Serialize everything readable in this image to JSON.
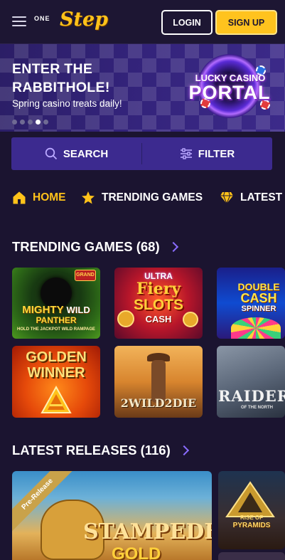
{
  "header": {
    "logo_one": "ONE",
    "logo_step": "Step",
    "login_label": "LOGIN",
    "signup_label": "SIGN UP"
  },
  "banner": {
    "title": "ENTER THE RABBITHOLE!",
    "subtitle": "Spring casino treats daily!",
    "portal_line1": "LUCKY CASINO",
    "portal_line2": "PORTAL",
    "slides_total": 5,
    "active_slide": 4
  },
  "search_bar": {
    "search_label": "SEARCH",
    "filter_label": "FILTER"
  },
  "nav": {
    "items": [
      {
        "label": "HOME",
        "icon": "home-icon",
        "active": true
      },
      {
        "label": "TRENDING GAMES",
        "icon": "star-icon",
        "active": false
      },
      {
        "label": "LATEST",
        "icon": "diamond-icon",
        "active": false
      }
    ]
  },
  "trending": {
    "title": "TRENDING GAMES (68)",
    "games": [
      {
        "name": "MIGHTY WILD PANTHER",
        "line1": "MIGHTY",
        "line2": "WILD",
        "line3": "PANTHER",
        "tagline": "HOLD THE JACKPOT WILD RAMPAGE",
        "badge": "GRAND"
      },
      {
        "name": "ULTRA FIERY SLOTS CASH",
        "line1": "ULTRA",
        "line2": "Fiery",
        "line3": "SLOTS",
        "line4": "CASH"
      },
      {
        "name": "DOUBLE CASH SPINNER",
        "line1": "DOUBLE",
        "line2": "CASH",
        "line3": "SPINNER"
      },
      {
        "name": "GOLDEN WINNER",
        "line1": "GOLDEN",
        "line2": "WINNER"
      },
      {
        "name": "2 WILD 2 DIE",
        "line1": "2WILD2DIE"
      },
      {
        "name": "RAIDERS OF THE NORTH",
        "line1": "RAIDER",
        "line2": "OF THE NORTH"
      }
    ]
  },
  "latest": {
    "title": "LATEST RELEASES (116)",
    "games": [
      {
        "name": "STAMPEDE GOLD",
        "line1": "STAMPEDE",
        "line2": "GOLD",
        "badge": "Pre-Release"
      },
      {
        "name": "RISE OF PYRAMIDS",
        "line1": "RISE OF",
        "line2": "PYRAMIDS"
      }
    ]
  },
  "colors": {
    "background": "#1b1430",
    "accent_yellow": "#ffc21a",
    "bar_purple": "#3c2a8f",
    "chevron_purple": "#8a6cff"
  }
}
